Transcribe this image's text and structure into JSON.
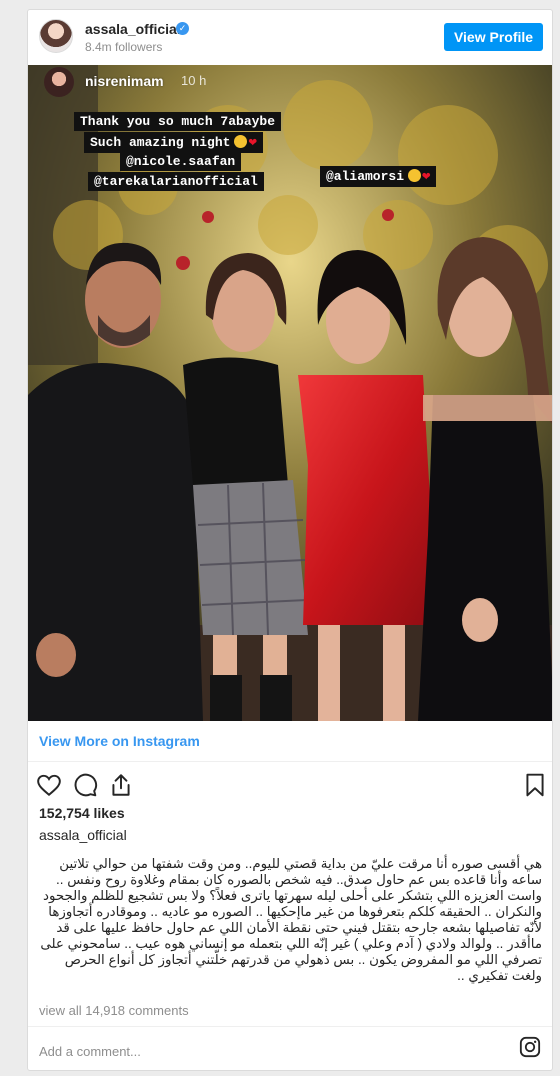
{
  "post": {
    "username": "assala_official",
    "followers": "8.4m followers",
    "view_profile_label": "View Profile"
  },
  "story": {
    "username": "nisrenimam",
    "time": "10 h",
    "sticker_lines": [
      "Thank you so much 7abaybe",
      "Such amazing night",
      "@nicole.saafan",
      "@tarekalarianofficial"
    ],
    "mention_tag": "@aliamorsi"
  },
  "footer": {
    "view_more_label": "View More on Instagram",
    "likes": "152,754 likes",
    "caption_username": "assala_official",
    "caption_text": "هي أقسى صوره أنا مرقت عليّ من بداية قصتي لليوم.. ومن وقت شفتها من حوالي تلاتين ساعه وأنا قاعده بس عم حاول صدق.. فيه شخص بالصوره كان بمقام وغلاوة روح ونفس .. واست العزيزه اللي بتشكر على أحلى ليله سهرتها ياترى فعلاً؟ ولا بس تشجيع للظلم والجحود والنكران .. الحقيقه كلكم بتعرفوها من غير ماإحكيها .. الصوره مو عاديه .. وموقادره أتجاوزها لأنّه تفاصيلها بشعه جارحه بتقتل فيني حتى نقطة الأمان اللي عم حاول حافظ عليها على قد ماأقدر .. ولوالد ولادي ( آدم وعلي ) غير إنّه اللي بتعمله مو إنساني هوه عيب .. سامحوني على تصرفي اللي مو المفروض يكون .. بس ذهولي من قدرتهم خلّتني أتجاوز كل أنواع الحرص ولغت تفكيري ..",
    "view_all_comments": "view all 14,918 comments",
    "add_comment_placeholder": "Add a comment..."
  },
  "colors": {
    "accent": "#0095f6",
    "link": "#3897f0",
    "muted": "#8e8e8e",
    "dress_red": "#d21d1d"
  },
  "icons": [
    "verified-badge-icon",
    "heart-icon",
    "comment-icon",
    "share-icon",
    "bookmark-icon",
    "instagram-glyph-icon"
  ]
}
